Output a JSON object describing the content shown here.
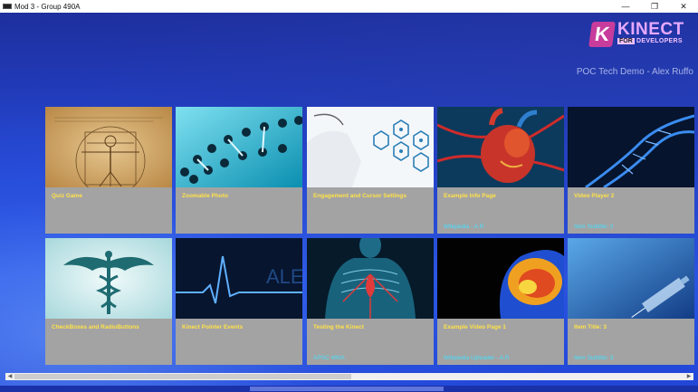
{
  "window": {
    "title": "Mod 3 - Group 490A",
    "minimize": "—",
    "restore": "❐",
    "close": "✕"
  },
  "header": {
    "logo_letter": "K",
    "logo_word": "KINECT",
    "logo_for": "FOR",
    "logo_developers": "DEVELOPERS",
    "subtitle": "POC Tech Demo - Alex Ruffo"
  },
  "colors": {
    "background": "#1f3fc8",
    "tile": "#a3a3a3",
    "label": "#ffe24a",
    "sublabel": "#46e0ff",
    "logo": "#c83c9c"
  },
  "tiles": [
    {
      "title": "Quiz Game",
      "subtitle": "",
      "image": "vitruvian-man-image"
    },
    {
      "title": "Zoomable Photo",
      "subtitle": "",
      "image": "dna-helix-image"
    },
    {
      "title": "Engagement and Cursor Settings",
      "subtitle": "",
      "image": "medical-hexagon-icons-image"
    },
    {
      "title": "Example Info Page",
      "subtitle": "Wikipedia - A.R",
      "image": "anatomical-heart-image"
    },
    {
      "title": "Video Player 2",
      "subtitle": "Item Subtitle: 2",
      "image": "blue-dna-image"
    },
    {
      "title": "CheckBoxes and RadioButtons",
      "subtitle": "",
      "image": "caduceus-image"
    },
    {
      "title": "Kinect Pointer Events",
      "subtitle": "",
      "image": "heart-monitor-alert-image"
    },
    {
      "title": "Testing the Kinect",
      "subtitle": "APSC 490A",
      "image": "xray-torso-image"
    },
    {
      "title": "Example Video Page 1",
      "subtitle": "Wikipedia Uploader - A.R",
      "image": "brain-scan-image"
    },
    {
      "title": "Item Title: 3",
      "subtitle": "Item Subtitle: 3",
      "image": "syringe-image"
    }
  ],
  "scrollbar": {
    "left_arrow": "◀",
    "right_arrow": "▶",
    "position": 0.0
  }
}
